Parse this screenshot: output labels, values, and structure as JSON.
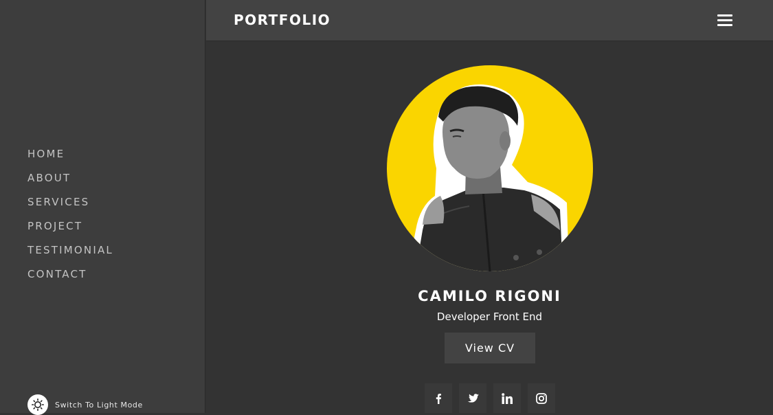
{
  "sidebar": {
    "nav": [
      "HOME",
      "ABOUT",
      "SERVICES",
      "PROJECT",
      "TESTIMONIAL",
      "CONTACT"
    ],
    "mode_toggle_label": "Switch To Light Mode",
    "mode_icon": "sun-icon"
  },
  "header": {
    "brand": "PORTFOLIO",
    "menu_icon": "hamburger-menu-icon"
  },
  "hero": {
    "name": "CAMILO RIGONI",
    "role": "Developer Front End",
    "cv_button": "View CV",
    "avatar_bg": "#fad500",
    "socials": [
      "facebook-icon",
      "twitter-icon",
      "linkedin-icon",
      "instagram-icon"
    ]
  },
  "colors": {
    "sidebar_bg": "#3d3d3d",
    "main_bg": "#333333",
    "accent": "#fad500"
  }
}
